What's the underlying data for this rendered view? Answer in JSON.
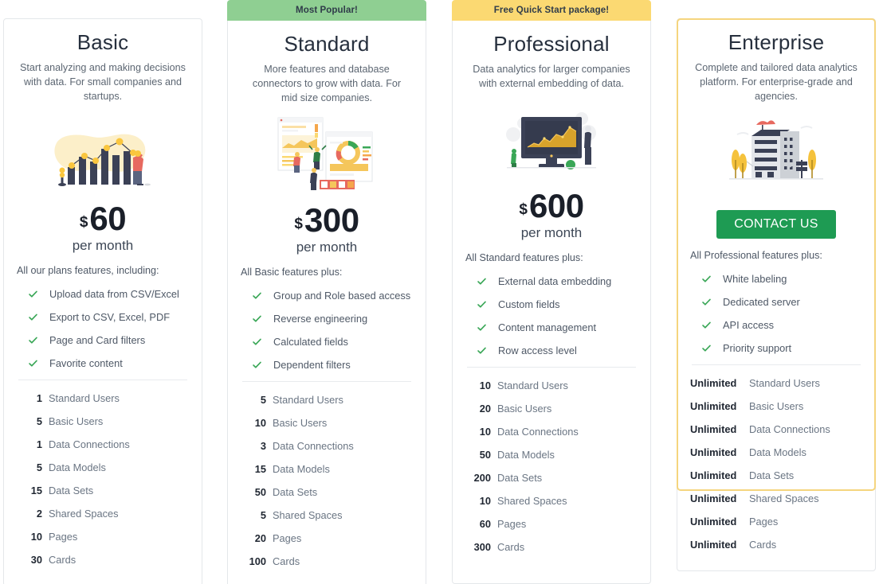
{
  "plans": [
    {
      "id": "basic",
      "banner": null,
      "banner_style": null,
      "name": "Basic",
      "description": "Start analyzing and making decisions with data. For small companies and startups.",
      "illustration": "bar-chart-illustration",
      "currency": "$",
      "price": "60",
      "period": "per month",
      "cta": null,
      "features_heading": "All our plans features, including:",
      "features": [
        "Upload data from CSV/Excel",
        "Export to CSV, Excel, PDF",
        "Page and Card filters",
        "Favorite content"
      ],
      "specs": [
        {
          "value": "1",
          "label": "Standard Users"
        },
        {
          "value": "5",
          "label": "Basic Users"
        },
        {
          "value": "1",
          "label": "Data Connections"
        },
        {
          "value": "5",
          "label": "Data Models"
        },
        {
          "value": "15",
          "label": "Data Sets"
        },
        {
          "value": "2",
          "label": "Shared Spaces"
        },
        {
          "value": "10",
          "label": "Pages"
        },
        {
          "value": "30",
          "label": "Cards"
        }
      ]
    },
    {
      "id": "standard",
      "banner": "Most Popular!",
      "banner_style": "green",
      "name": "Standard",
      "description": "More features and database connectors to grow with data. For mid size companies.",
      "illustration": "dashboard-panels-illustration",
      "currency": "$",
      "price": "300",
      "period": "per month",
      "cta": null,
      "features_heading": "All Basic features plus:",
      "features": [
        "Group and Role based access",
        "Reverse engineering",
        "Calculated fields",
        "Dependent filters"
      ],
      "specs": [
        {
          "value": "5",
          "label": "Standard Users"
        },
        {
          "value": "10",
          "label": "Basic Users"
        },
        {
          "value": "3",
          "label": "Data Connections"
        },
        {
          "value": "15",
          "label": "Data Models"
        },
        {
          "value": "50",
          "label": "Data Sets"
        },
        {
          "value": "5",
          "label": "Shared Spaces"
        },
        {
          "value": "20",
          "label": "Pages"
        },
        {
          "value": "100",
          "label": "Cards"
        }
      ]
    },
    {
      "id": "professional",
      "banner": "Free Quick Start package!",
      "banner_style": "yellow",
      "name": "Professional",
      "description": "Data analytics for larger companies with external embedding of data.",
      "illustration": "monitor-chart-illustration",
      "currency": "$",
      "price": "600",
      "period": "per month",
      "cta": null,
      "features_heading": "All Standard features plus:",
      "features": [
        "External data embedding",
        "Custom fields",
        "Content management",
        "Row access level"
      ],
      "specs": [
        {
          "value": "10",
          "label": "Standard Users"
        },
        {
          "value": "20",
          "label": "Basic Users"
        },
        {
          "value": "10",
          "label": "Data Connections"
        },
        {
          "value": "50",
          "label": "Data Models"
        },
        {
          "value": "200",
          "label": "Data Sets"
        },
        {
          "value": "10",
          "label": "Shared Spaces"
        },
        {
          "value": "60",
          "label": "Pages"
        },
        {
          "value": "300",
          "label": "Cards"
        }
      ]
    },
    {
      "id": "enterprise",
      "banner": null,
      "banner_style": null,
      "name": "Enterprise",
      "description": "Complete and tailored data analytics platform. For enterprise-grade and agencies.",
      "illustration": "office-building-illustration",
      "currency": null,
      "price": null,
      "period": null,
      "cta": "CONTACT US",
      "features_heading": "All Professional features plus:",
      "features": [
        "White labeling",
        "Dedicated server",
        "API access",
        "Priority support"
      ],
      "specs": [
        {
          "value": "Unlimited",
          "label": "Standard Users"
        },
        {
          "value": "Unlimited",
          "label": "Basic Users"
        },
        {
          "value": "Unlimited",
          "label": "Data Connections"
        },
        {
          "value": "Unlimited",
          "label": "Data Models"
        },
        {
          "value": "Unlimited",
          "label": "Data Sets"
        },
        {
          "value": "Unlimited",
          "label": "Shared Spaces"
        },
        {
          "value": "Unlimited",
          "label": "Pages"
        },
        {
          "value": "Unlimited",
          "label": "Cards"
        }
      ]
    }
  ],
  "colors": {
    "banner_green": "#8fcf92",
    "banner_yellow": "#fbd972",
    "cta_green": "#1e9b53",
    "check_green": "#3aa757",
    "enterprise_border": "#f5d57e",
    "card_border": "#e4e7ea",
    "heading_text": "#262f3d",
    "body_text": "#5c6672"
  }
}
